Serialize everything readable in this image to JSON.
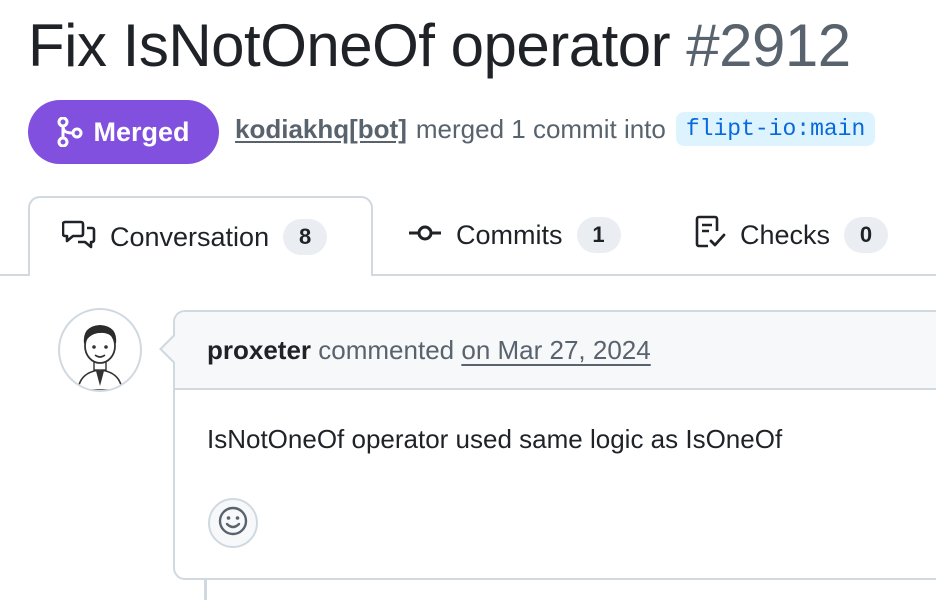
{
  "pr": {
    "title": "Fix IsNotOneOf operator",
    "number": "#2912",
    "state": "Merged",
    "author": "kodiakhq[bot]",
    "merge_text": "merged 1 commit into",
    "base_branch": "flipt-io:main"
  },
  "tabs": [
    {
      "label": "Conversation",
      "count": "8",
      "icon": "comment-discussion-icon"
    },
    {
      "label": "Commits",
      "count": "1",
      "icon": "git-commit-icon"
    },
    {
      "label": "Checks",
      "count": "0",
      "icon": "checklist-icon"
    }
  ],
  "comment": {
    "author": "proxeter",
    "action": "commented",
    "time": "on Mar 27, 2024",
    "body": "IsNotOneOf operator used same logic as IsOneOf",
    "reaction_icon": "smiley-icon"
  },
  "colors": {
    "merged": "#8250df",
    "branch_bg": "#ddf4ff",
    "branch_fg": "#0969da",
    "border": "#d1d9e0",
    "muted": "#59636e"
  }
}
